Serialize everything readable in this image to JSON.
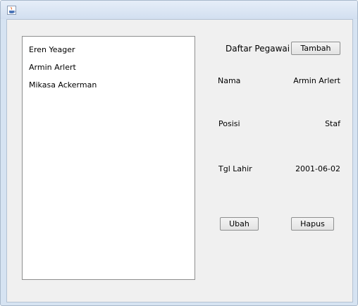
{
  "window": {
    "icon": "java-icon"
  },
  "list": {
    "items": [
      {
        "label": "Eren Yeager"
      },
      {
        "label": "Armin Arlert"
      },
      {
        "label": "Mikasa Ackerman"
      }
    ]
  },
  "header": {
    "title": "Daftar Pegawai",
    "add_label": "Tambah"
  },
  "details": {
    "nama_label": "Nama",
    "nama_value": "Armin Arlert",
    "posisi_label": "Posisi",
    "posisi_value": "Staf",
    "tgl_label": "Tgl Lahir",
    "tgl_value": "2001-06-02"
  },
  "actions": {
    "edit_label": "Ubah",
    "delete_label": "Hapus"
  }
}
